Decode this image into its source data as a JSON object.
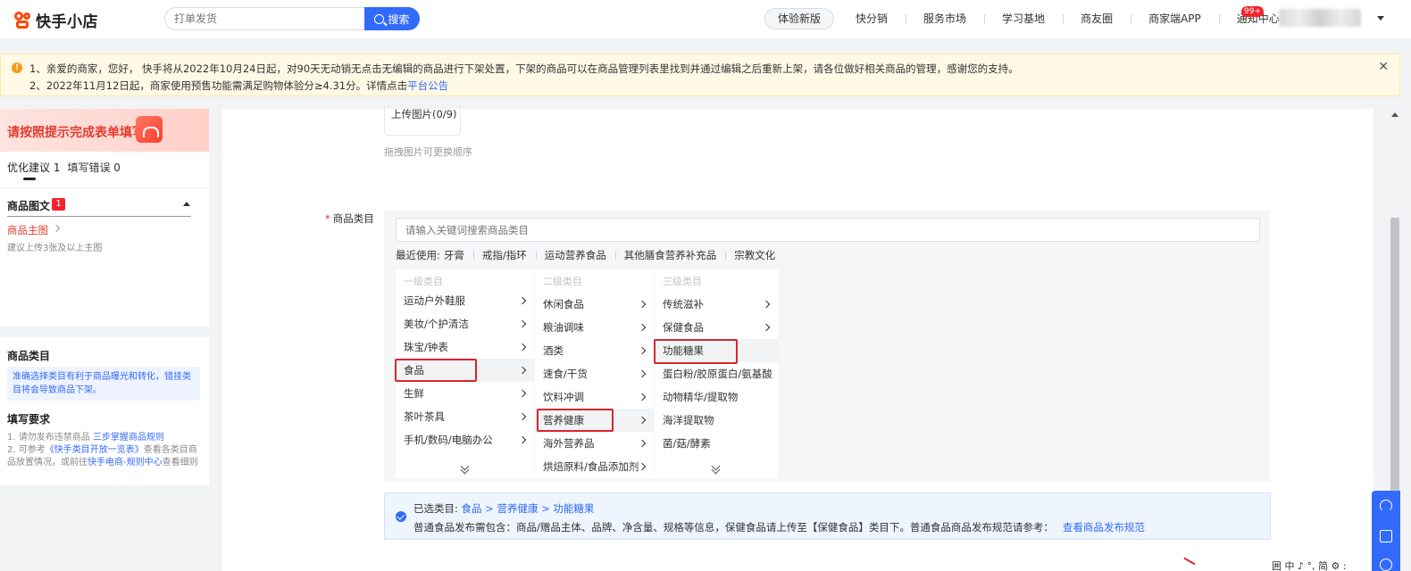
{
  "header": {
    "logo_text": "快手小店",
    "search_placeholder": "打单发货",
    "search_button": "搜索",
    "nav_pill": "体验新版",
    "nav_items": [
      "快分销",
      "服务市场",
      "学习基地",
      "商友圈",
      "商家端APP",
      "通知中心"
    ],
    "notification_badge": "99+"
  },
  "notice": {
    "line1": "1、亲爱的商家，您好， 快手将从2022年10月24日起，对90天无动销无点击无编辑的商品进行下架处置，下架的商品可以在商品管理列表里找到并通过编辑之后重新上架，请各位做好相关商品的管理，感谢您的支持。",
    "line2_prefix": "2、2022年11月12日起，商家使用预售功能需满足购物体验分≥4.31分。详情点击",
    "line2_link": "平台公告",
    "close": "✕"
  },
  "left_panel": {
    "title": "请按照提示完成表单填写",
    "tab_optimize": "优化建议 1",
    "tab_errors": "填写错误 0",
    "section_title": "商品图文",
    "section_count": "1",
    "main_image_link": "商品主图",
    "main_image_hint": "建议上传3张及以上主图"
  },
  "left_panel2": {
    "title": "商品类目",
    "tip": "准确选择类目有利于商品曝光和转化，错挂类目将会导致商品下架。",
    "requirements_title": "填写要求",
    "rule1_prefix": "1. 请勿发布违禁商品 ",
    "rule1_link": "三步掌握商品规则",
    "rule2_prefix": "2. 可参考",
    "rule2_link": "《快手类目开放一览表》",
    "rule2_suffix": "查看各类目商",
    "rule3_prefix": "品放置情况，或前往",
    "rule3_link": "快手电商-规则中心",
    "rule3_suffix": "查看细则"
  },
  "main": {
    "upload_text": "上传图片(0/9)",
    "drag_hint": "拖拽图片可更换顺序",
    "category_label": "商品类目",
    "category_search_placeholder": "请输入关键词搜索商品类目",
    "recent_label": "最近使用:",
    "recent_items": [
      "牙膏",
      "戒指/指环",
      "运动营养食品",
      "其他膳食营养补充品",
      "宗教文化"
    ],
    "col1": {
      "header": "一级类目",
      "items": [
        "运动户外鞋服",
        "美妆/个护清洁",
        "珠宝/钟表",
        "食品",
        "生鲜",
        "茶叶茶具",
        "手机/数码/电脑办公"
      ]
    },
    "col2": {
      "header": "二级类目",
      "items": [
        "休闲食品",
        "粮油调味",
        "酒类",
        "速食/干货",
        "饮料冲调",
        "营养健康",
        "海外营养品",
        "烘焙原料/食品添加剂"
      ]
    },
    "col3": {
      "header": "三级类目",
      "items": [
        "传统滋补",
        "保健食品",
        "功能糖果",
        "蛋白粉/胶原蛋白/氨基酸",
        "动物精华/提取物",
        "海洋提取物",
        "菌/菇/酵素"
      ]
    },
    "selected_label": "已选类目:",
    "selected_path": "食品 > 营养健康 > 功能糖果",
    "selected_note": "普通食品发布需包含：商品/赠品主体、品牌、净含量、规格等信息，保健食品请上传至【保健食品】类目下。普通食品商品发布规范请参考：",
    "selected_link": "查看商品发布规范"
  },
  "bottom_tools": "囲 中 ♪ °, 简 ⚙ :"
}
